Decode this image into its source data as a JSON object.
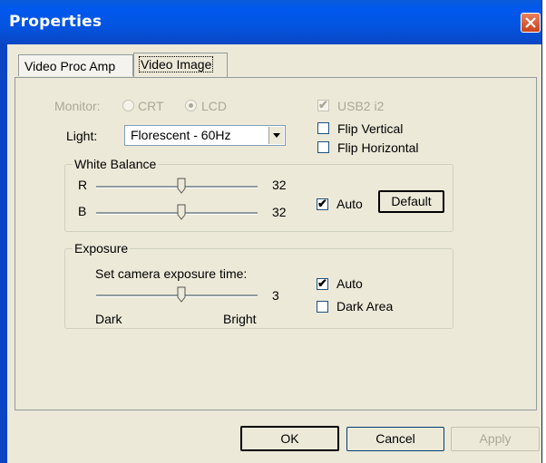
{
  "window": {
    "title": "Properties"
  },
  "tabs": [
    {
      "label": "Video Proc Amp"
    },
    {
      "label": "Video Image"
    }
  ],
  "monitor": {
    "label": "Monitor:",
    "options": [
      "CRT",
      "LCD"
    ],
    "selected": "LCD"
  },
  "usb2": {
    "label": "USB2 i2",
    "checked": true
  },
  "flip_vertical": {
    "label": "Flip Vertical",
    "checked": false
  },
  "flip_horizontal": {
    "label": "Flip Horizontal",
    "checked": false
  },
  "light": {
    "label": "Light:",
    "value": "Florescent - 60Hz"
  },
  "white_balance": {
    "title": "White Balance",
    "r": {
      "label": "R",
      "value": "32",
      "level": 0.5
    },
    "b": {
      "label": "B",
      "value": "32",
      "level": 0.5
    },
    "auto": {
      "label": "Auto",
      "checked": true
    },
    "default_label": "Default"
  },
  "exposure": {
    "title": "Exposure",
    "caption": "Set camera exposure time:",
    "value": "3",
    "level": 0.5,
    "min_label": "Dark",
    "max_label": "Bright",
    "auto": {
      "label": "Auto",
      "checked": true
    },
    "dark_area": {
      "label": "Dark Area",
      "checked": false
    }
  },
  "buttons": {
    "ok": "OK",
    "cancel": "Cancel",
    "apply": "Apply"
  }
}
